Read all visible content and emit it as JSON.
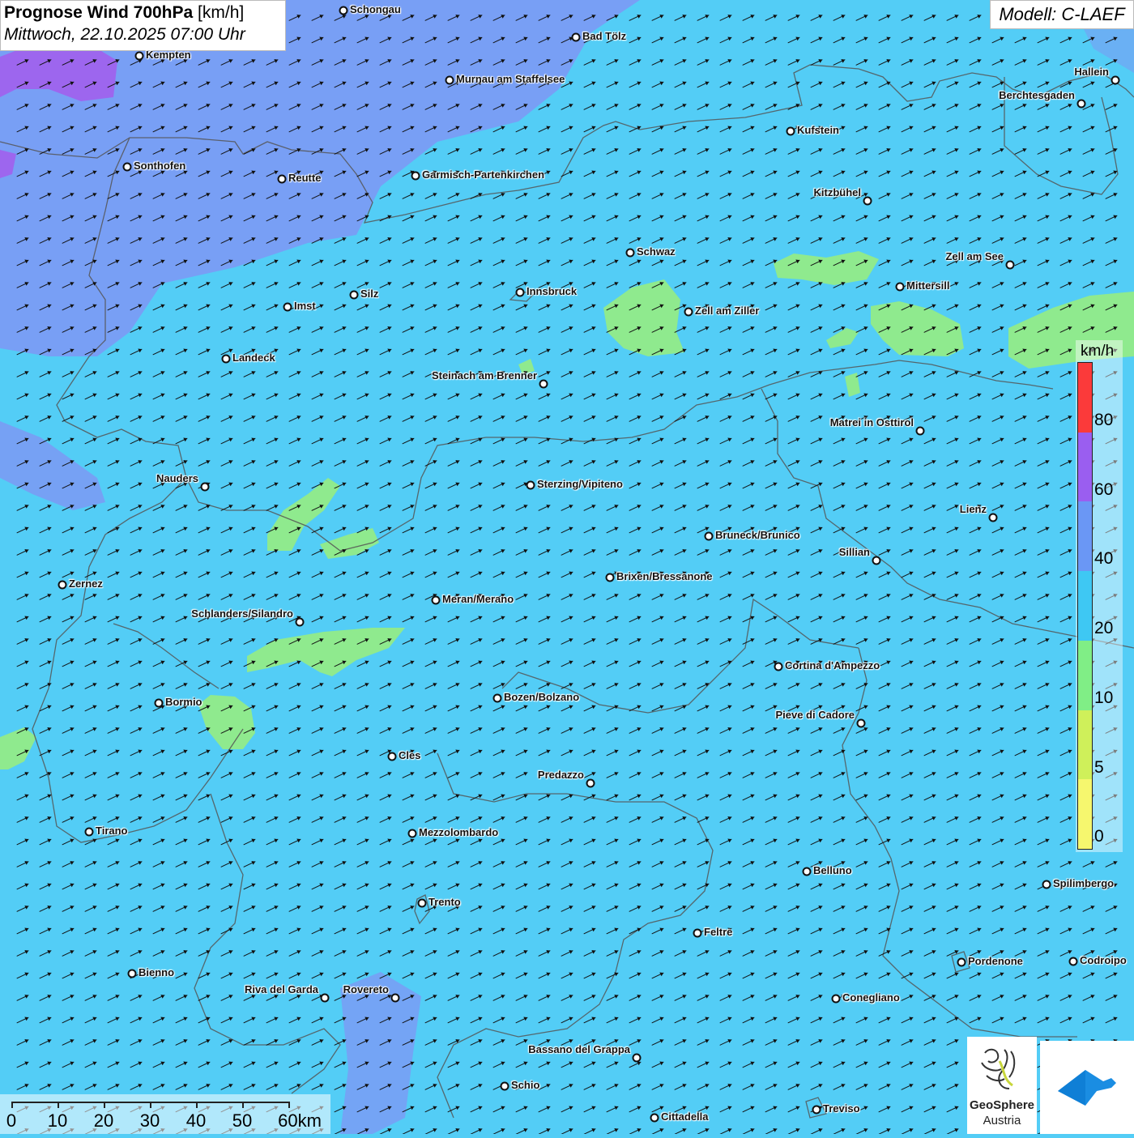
{
  "title": {
    "main": "Prognose Wind 700hPa",
    "unit": "[km/h]",
    "datetime": "Mittwoch, 22.10.2025 07:00 Uhr"
  },
  "model": "Modell: C-LAEF",
  "cities": [
    {
      "name": "Schongau"
    },
    {
      "name": "Bad Tölz"
    },
    {
      "name": "Kempten"
    },
    {
      "name": "Murnau am Staffelsee"
    },
    {
      "name": "Hallein"
    },
    {
      "name": "Berchtesgaden"
    },
    {
      "name": "Kufstein"
    },
    {
      "name": "Sonthofen"
    },
    {
      "name": "Reutte"
    },
    {
      "name": "Garmisch-Partenkirchen"
    },
    {
      "name": "Kitzbühel"
    },
    {
      "name": "Schwaz"
    },
    {
      "name": "Zell am See"
    },
    {
      "name": "Mittersill"
    },
    {
      "name": "Innsbruck"
    },
    {
      "name": "Imst"
    },
    {
      "name": "Silz"
    },
    {
      "name": "Zell am Ziller"
    },
    {
      "name": "Landeck"
    },
    {
      "name": "Steinach am Brenner"
    },
    {
      "name": "Matrei in Osttirol"
    },
    {
      "name": "Nauders"
    },
    {
      "name": "Sterzing/Vipiteno"
    },
    {
      "name": "Lienz"
    },
    {
      "name": "Bruneck/Brunico"
    },
    {
      "name": "Sillian"
    },
    {
      "name": "Brixen/Bressanone"
    },
    {
      "name": "Zernez"
    },
    {
      "name": "Meran/Merano"
    },
    {
      "name": "Schlanders/Silandro"
    },
    {
      "name": "Cortina d'Ampezzo"
    },
    {
      "name": "Bozen/Bolzano"
    },
    {
      "name": "Bormio"
    },
    {
      "name": "Pieve di Cadore"
    },
    {
      "name": "Cles"
    },
    {
      "name": "Predazzo"
    },
    {
      "name": "Tirano"
    },
    {
      "name": "Mezzolombardo"
    },
    {
      "name": "Belluno"
    },
    {
      "name": "Spilimbergo"
    },
    {
      "name": "Trento"
    },
    {
      "name": "Feltre"
    },
    {
      "name": "Pordenone"
    },
    {
      "name": "Codroipo"
    },
    {
      "name": "Bienno"
    },
    {
      "name": "Riva del Garda"
    },
    {
      "name": "Rovereto"
    },
    {
      "name": "Conegliano"
    },
    {
      "name": "Bassano del Grappa"
    },
    {
      "name": "Schio"
    },
    {
      "name": "Treviso"
    },
    {
      "name": "Cittadella"
    }
  ],
  "legend": {
    "unit": "km/h",
    "labels": [
      "80",
      "60",
      "40",
      "20",
      "10",
      "5",
      "0"
    ],
    "colors": [
      "#fb3a3a",
      "#9a5ef0",
      "#6a97f5",
      "#3ec8f3",
      "#80ee86",
      "#cff05a",
      "#f6f76e"
    ]
  },
  "scalebar": {
    "labels": [
      "0",
      "10",
      "20",
      "30",
      "40",
      "50",
      "60km"
    ]
  },
  "wind_direction": "from west-southwest",
  "colors": {
    "background_field": "#53cdf6",
    "stronger_field": "#7896f4",
    "strongest_field": "#9d66ee",
    "weak_field": "#8de98a",
    "borders": "#555"
  },
  "logo": {
    "name": "GeoSphere",
    "sub": "Austria"
  }
}
